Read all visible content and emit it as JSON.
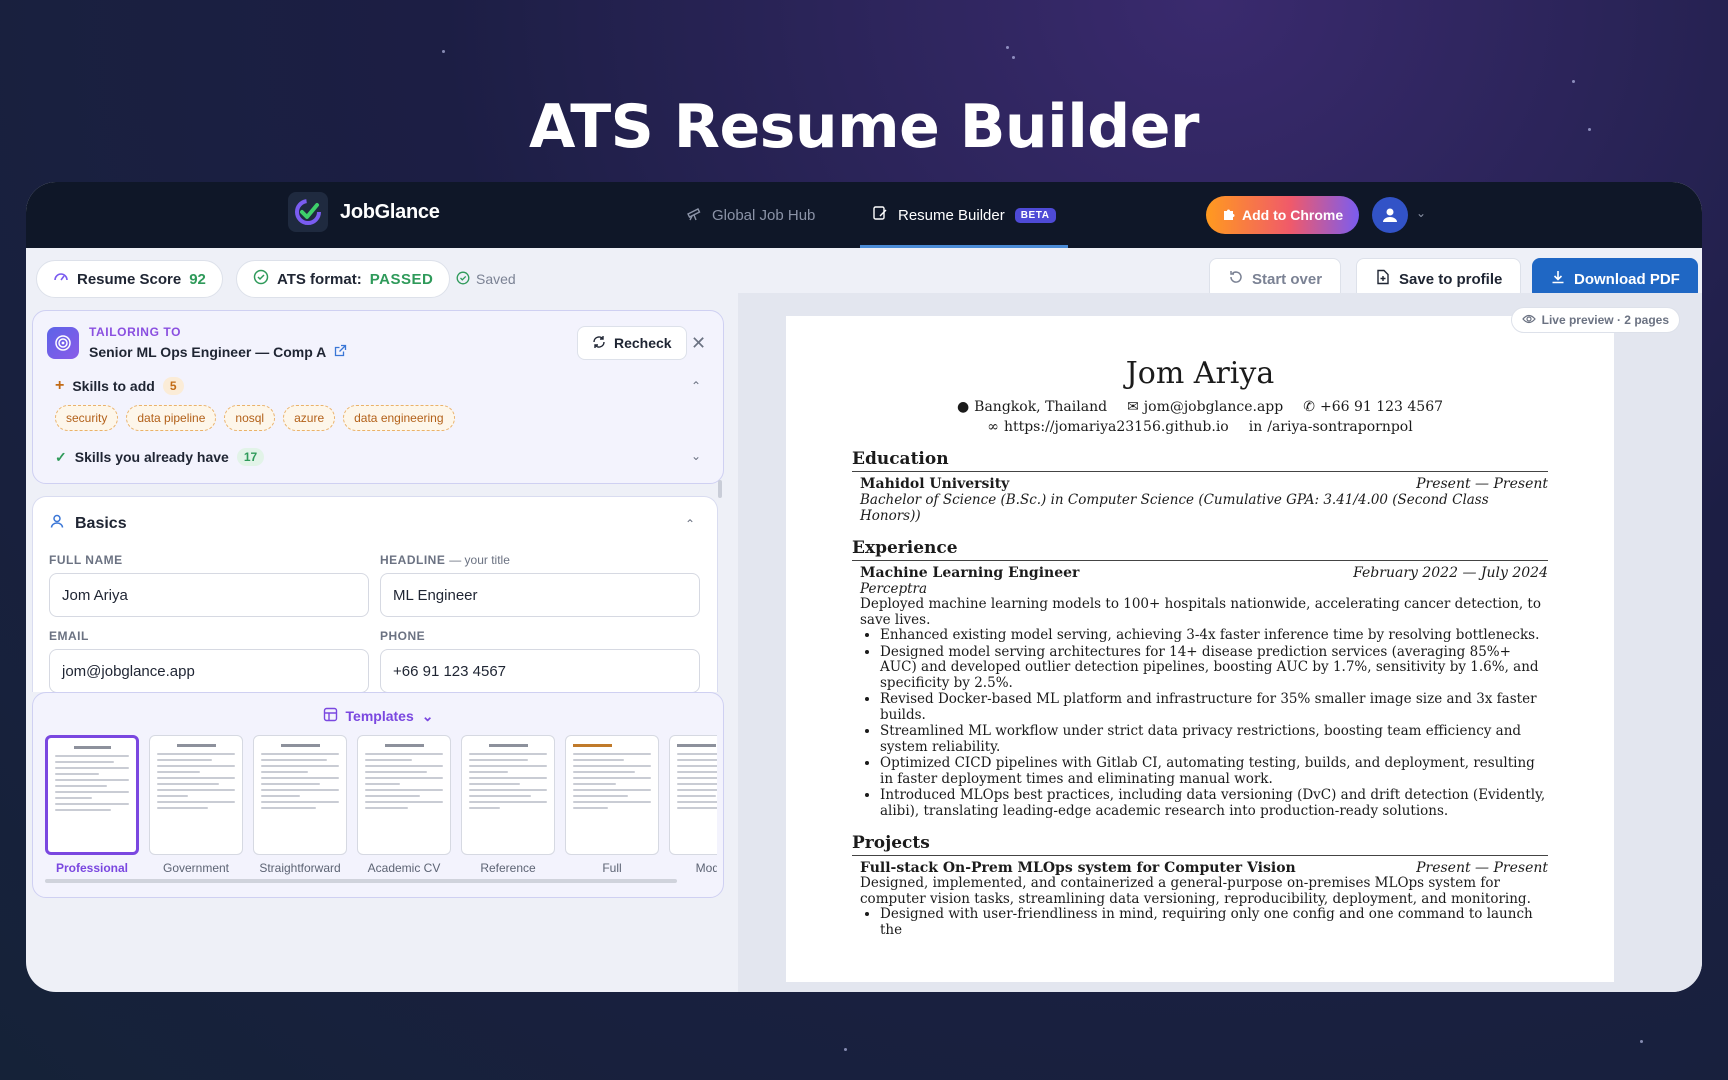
{
  "hero": {
    "title": "ATS Resume Builder"
  },
  "nav": {
    "brand": "JobGlance",
    "tabs": [
      {
        "label": "Global Job Hub"
      },
      {
        "label": "Resume Builder",
        "badge": "BETA"
      }
    ],
    "chrome_button": "Add to Chrome"
  },
  "toolbar": {
    "score_label": "Resume Score",
    "score_value": "92",
    "ats_label": "ATS format:",
    "ats_value": "PASSED",
    "saved": "Saved",
    "start_over": "Start over",
    "save_profile": "Save to profile",
    "download": "Download PDF"
  },
  "tailoring": {
    "kicker": "TAILORING TO",
    "role": "Senior ML Ops Engineer — Comp A",
    "recheck": "Recheck",
    "skills_add_label": "Skills to add",
    "skills_add_count": "5",
    "skills_add": [
      "security",
      "data pipeline",
      "nosql",
      "azure",
      "data engineering"
    ],
    "skills_have_label": "Skills you already have",
    "skills_have_count": "17"
  },
  "basics": {
    "title": "Basics",
    "full_name_label": "FULL NAME",
    "full_name": "Jom Ariya",
    "headline_label": "HEADLINE",
    "headline_hint": "— your title",
    "headline": "ML Engineer",
    "email_label": "EMAIL",
    "email": "jom@jobglance.app",
    "phone_label": "PHONE",
    "phone": "+66 91 123 4567"
  },
  "templates": {
    "title": "Templates",
    "items": [
      "Professional",
      "Government",
      "Straightforward",
      "Academic CV",
      "Reference",
      "Full",
      "Modern"
    ],
    "selected": "Professional"
  },
  "preview": {
    "badge": "Live preview · 2 pages",
    "name": "Jom Ariya",
    "location": "Bangkok, Thailand",
    "email": "jom@jobglance.app",
    "phone": "+66 91 123 4567",
    "website": "https://jomariya23156.github.io",
    "linkedin": "/ariya-sontrapornpol",
    "education_title": "Education",
    "edu_school": "Mahidol University",
    "edu_dates": "Present — Present",
    "edu_degree": "Bachelor of Science (B.Sc.) in Computer Science (Cumulative GPA: 3.41/4.00 (Second Class Honors))",
    "experience_title": "Experience",
    "exp_role": "Machine Learning Engineer",
    "exp_dates": "February 2022 — July 2024",
    "exp_company": "Perceptra",
    "exp_summary": "Deployed machine learning models to 100+ hospitals nationwide, accelerating cancer detection, to save lives.",
    "exp_bullets": [
      "Enhanced existing model serving, achieving 3-4x faster inference time by resolving bottlenecks.",
      "Designed model serving architectures for 14+ disease prediction services (averaging 85%+ AUC) and developed outlier detection pipelines, boosting AUC by 1.7%, sensitivity by 1.6%, and specificity by 2.5%.",
      "Revised Docker-based ML platform and infrastructure for 35% smaller image size and 3x faster builds.",
      "Streamlined ML workflow under strict data privacy restrictions, boosting team efficiency and system reliability.",
      "Optimized CICD pipelines with Gitlab CI, automating testing, builds, and deployment, resulting in faster deployment times and eliminating manual work.",
      "Introduced MLOps best practices, including data versioning (DvC) and drift detection (Evidently, alibi), translating leading-edge academic research into production-ready solutions."
    ],
    "projects_title": "Projects",
    "proj_title": "Full-stack On-Prem MLOps system for Computer Vision",
    "proj_dates": "Present — Present",
    "proj_summary": "Designed, implemented, and containerized a general-purpose on-premises MLOps system for computer vision tasks, streamlining data versioning, reproducibility, deployment, and monitoring.",
    "proj_bullets": [
      "Designed with user-friendliness in mind, requiring only one config and one command to launch the"
    ]
  }
}
